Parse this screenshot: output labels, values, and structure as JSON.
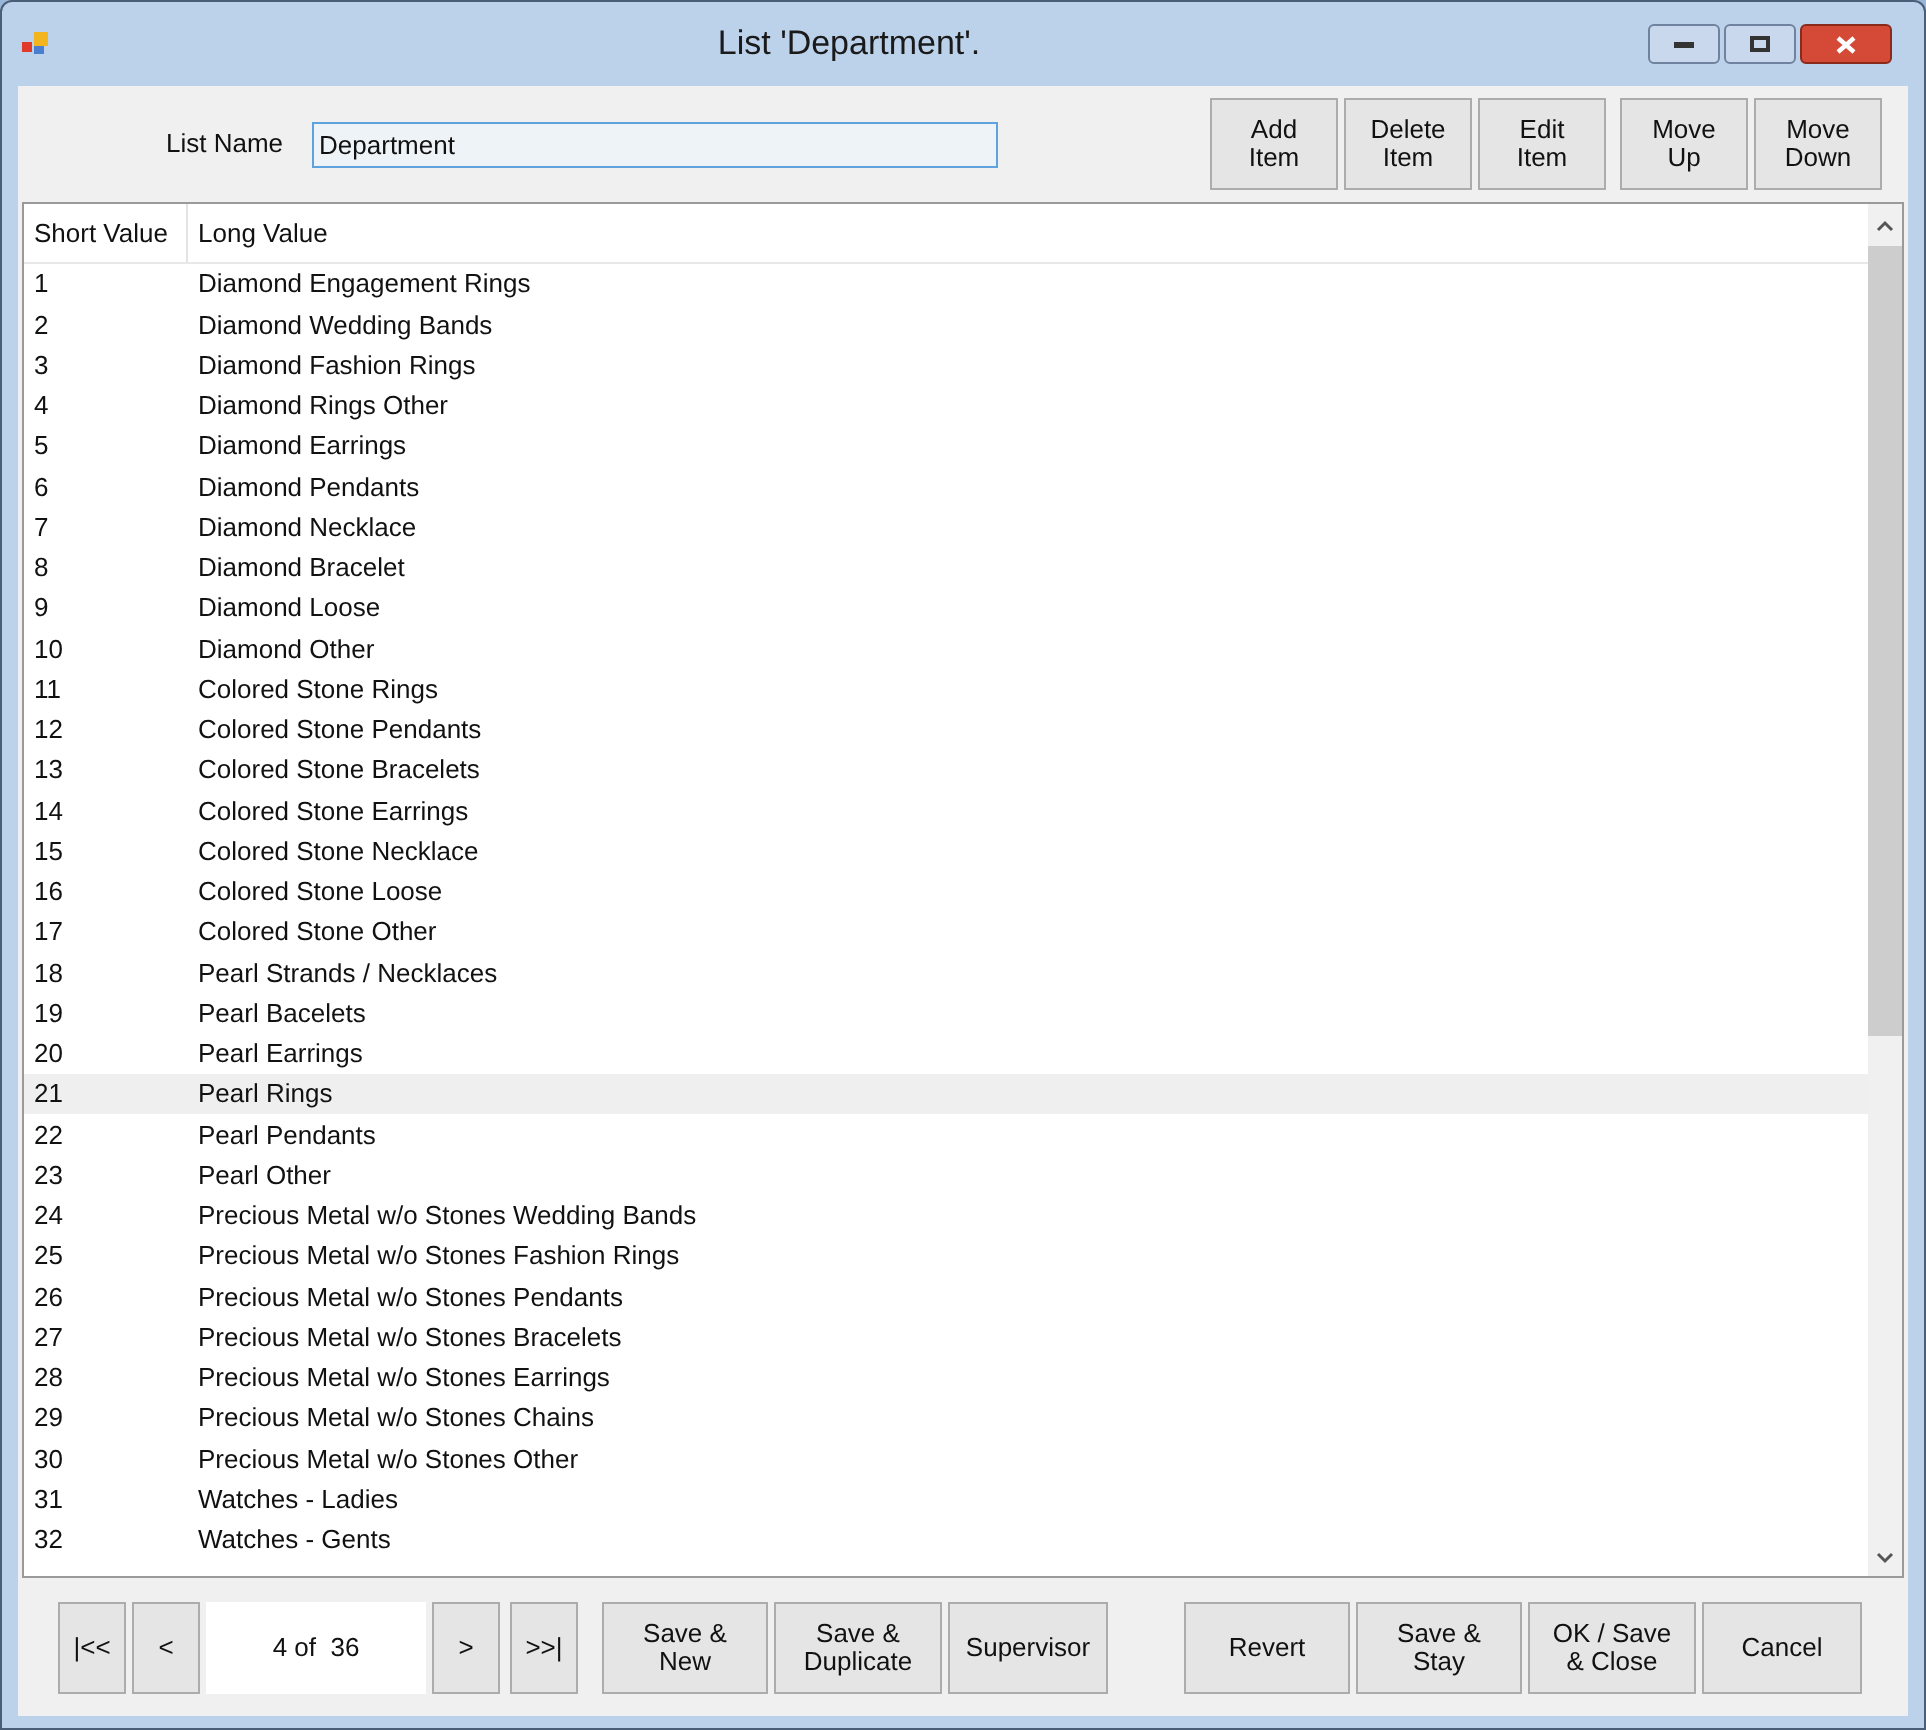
{
  "window": {
    "title": "List 'Department'."
  },
  "list_name": {
    "label": "List Name",
    "value": "Department"
  },
  "toolbar": [
    [
      "Add\nItem",
      "Delete\nItem",
      "Edit\nItem"
    ],
    [
      "Move\nUp",
      "Move\nDown"
    ]
  ],
  "table": {
    "columns": [
      "Short Value",
      "Long Value"
    ],
    "rows": [
      {
        "short": "1",
        "long": "Diamond Engagement Rings",
        "selected": false
      },
      {
        "short": "2",
        "long": "Diamond Wedding Bands",
        "selected": false
      },
      {
        "short": "3",
        "long": "Diamond Fashion Rings",
        "selected": false
      },
      {
        "short": "4",
        "long": "Diamond Rings Other",
        "selected": false
      },
      {
        "short": "5",
        "long": "Diamond Earrings",
        "selected": false
      },
      {
        "short": "6",
        "long": "Diamond Pendants",
        "selected": false
      },
      {
        "short": "7",
        "long": "Diamond Necklace",
        "selected": false
      },
      {
        "short": "8",
        "long": "Diamond Bracelet",
        "selected": false
      },
      {
        "short": "9",
        "long": "Diamond Loose",
        "selected": false
      },
      {
        "short": "10",
        "long": "Diamond Other",
        "selected": false
      },
      {
        "short": "11",
        "long": "Colored Stone Rings",
        "selected": false
      },
      {
        "short": "12",
        "long": "Colored Stone Pendants",
        "selected": false
      },
      {
        "short": "13",
        "long": "Colored Stone Bracelets",
        "selected": false
      },
      {
        "short": "14",
        "long": "Colored Stone Earrings",
        "selected": false
      },
      {
        "short": "15",
        "long": "Colored Stone Necklace",
        "selected": false
      },
      {
        "short": "16",
        "long": "Colored Stone Loose",
        "selected": false
      },
      {
        "short": "17",
        "long": "Colored Stone Other",
        "selected": false
      },
      {
        "short": "18",
        "long": "Pearl Strands / Necklaces",
        "selected": false
      },
      {
        "short": "19",
        "long": "Pearl Bacelets",
        "selected": false
      },
      {
        "short": "20",
        "long": "Pearl Earrings",
        "selected": false
      },
      {
        "short": "21",
        "long": "Pearl Rings",
        "selected": true
      },
      {
        "short": "22",
        "long": "Pearl Pendants",
        "selected": false
      },
      {
        "short": "23",
        "long": "Pearl Other",
        "selected": false
      },
      {
        "short": "24",
        "long": "Precious Metal w/o Stones Wedding Bands",
        "selected": false
      },
      {
        "short": "25",
        "long": "Precious Metal w/o Stones Fashion Rings",
        "selected": false
      },
      {
        "short": "26",
        "long": "Precious Metal w/o Stones Pendants",
        "selected": false
      },
      {
        "short": "27",
        "long": "Precious Metal w/o Stones Bracelets",
        "selected": false
      },
      {
        "short": "28",
        "long": "Precious Metal w/o Stones Earrings",
        "selected": false
      },
      {
        "short": "29",
        "long": "Precious Metal w/o Stones Chains",
        "selected": false
      },
      {
        "short": "30",
        "long": "Precious Metal w/o Stones Other",
        "selected": false
      },
      {
        "short": "31",
        "long": "Watches - Ladies",
        "selected": false
      },
      {
        "short": "32",
        "long": "Watches - Gents",
        "selected": false
      }
    ]
  },
  "navigator": {
    "first": "|<<",
    "prev": "<",
    "position": "4 of  36",
    "next": ">",
    "last": ">>|"
  },
  "actions": [
    [
      "Save &\nNew",
      "Save &\nDuplicate",
      "Supervisor"
    ],
    [
      "Revert",
      "Save &\nStay",
      "OK / Save\n& Close",
      "Cancel"
    ]
  ]
}
